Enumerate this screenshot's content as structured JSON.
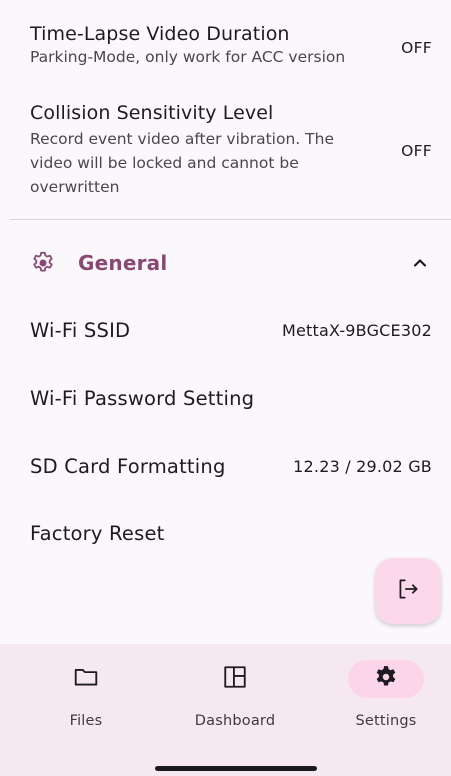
{
  "settings": {
    "time_lapse": {
      "title": "Time-Lapse Video Duration",
      "description": "Parking-Mode, only work for ACC version",
      "value": "OFF"
    },
    "collision": {
      "title": "Collision Sensitivity Level",
      "description": "Record event video after vibration. The video will be locked and cannot be overwritten",
      "value": "OFF"
    }
  },
  "general_section": {
    "icon": "gear-outline-icon",
    "title": "General",
    "accent_color": "#874873",
    "expanded": true,
    "rows": [
      {
        "label": "Wi-Fi SSID",
        "value": "MettaX-9BGCE302"
      },
      {
        "label": "Wi-Fi Password Setting",
        "value": ""
      },
      {
        "label": "SD Card Formatting",
        "value": "12.23 / 29.02 GB"
      },
      {
        "label": "Factory Reset",
        "value": ""
      }
    ]
  },
  "fab": {
    "icon": "logout-icon",
    "color": "#fcd9ea"
  },
  "bottom_nav": {
    "items": [
      {
        "label": "Files",
        "icon": "folder-icon",
        "active": false
      },
      {
        "label": "Dashboard",
        "icon": "dashboard-icon",
        "active": false
      },
      {
        "label": "Settings",
        "icon": "gear-icon",
        "active": true
      }
    ],
    "active_indicator_color": "#fcd6e8"
  }
}
